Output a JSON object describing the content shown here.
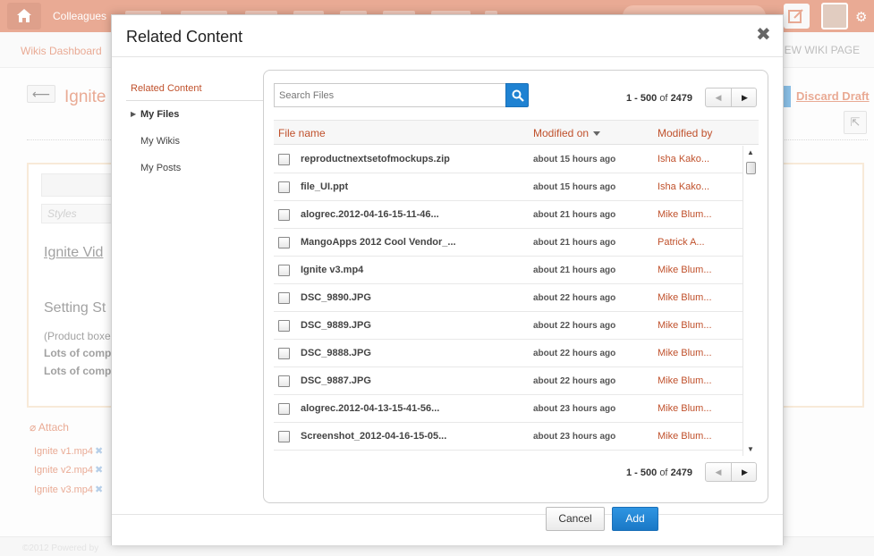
{
  "background": {
    "nav_colleagues": "Colleagues",
    "breadcrumb": "Wikis Dashboard",
    "new_wiki_page": "NEW WIKI PAGE",
    "back_arrow": "⟵",
    "page_title": "Ignite",
    "discard_draft": "Discard Draft",
    "styles_placeholder": "Styles",
    "editor_lines": [
      "Ignite Vid",
      "Setting St",
      "(Product boxe",
      "Lots of comp",
      "Lots of comp"
    ],
    "attach_label": "Attach",
    "attachments": [
      "Ignite v1.mp4",
      "Ignite v2.mp4",
      "Ignite v3.mp4"
    ],
    "remove_glyph": "✖",
    "footer_text": "©2012 Powered by"
  },
  "modal": {
    "title": "Related Content",
    "close_glyph": "✖",
    "nav": {
      "heading": "Related Content",
      "items": [
        {
          "label": "My Files",
          "active": true
        },
        {
          "label": "My Wikis",
          "active": false
        },
        {
          "label": "My Posts",
          "active": false
        }
      ]
    },
    "search": {
      "placeholder": "Search Files"
    },
    "pager": {
      "range": "1 - 500",
      "of": "of",
      "total": "2479"
    },
    "columns": {
      "name": "File name",
      "modified_on": "Modified on",
      "modified_by": "Modified by"
    },
    "files": [
      {
        "name": "reproductnextsetofmockups.zip",
        "modified_on": "about 15 hours ago",
        "modified_by": "Isha Kako..."
      },
      {
        "name": "file_UI.ppt",
        "modified_on": "about 15 hours ago",
        "modified_by": "Isha Kako..."
      },
      {
        "name": "alogrec.2012-04-16-15-11-46...",
        "modified_on": "about 21 hours ago",
        "modified_by": "Mike Blum..."
      },
      {
        "name": "MangoApps 2012 Cool Vendor_...",
        "modified_on": "about 21 hours ago",
        "modified_by": "Patrick A..."
      },
      {
        "name": "Ignite v3.mp4",
        "modified_on": "about 21 hours ago",
        "modified_by": "Mike Blum..."
      },
      {
        "name": "DSC_9890.JPG",
        "modified_on": "about 22 hours ago",
        "modified_by": "Mike Blum..."
      },
      {
        "name": "DSC_9889.JPG",
        "modified_on": "about 22 hours ago",
        "modified_by": "Mike Blum..."
      },
      {
        "name": "DSC_9888.JPG",
        "modified_on": "about 22 hours ago",
        "modified_by": "Mike Blum..."
      },
      {
        "name": "DSC_9887.JPG",
        "modified_on": "about 22 hours ago",
        "modified_by": "Mike Blum..."
      },
      {
        "name": "alogrec.2012-04-13-15-41-56...",
        "modified_on": "about 23 hours ago",
        "modified_by": "Mike Blum..."
      },
      {
        "name": "Screenshot_2012-04-16-15-05...",
        "modified_on": "about 23 hours ago",
        "modified_by": "Mike Blum..."
      }
    ],
    "buttons": {
      "cancel": "Cancel",
      "add": "Add"
    }
  },
  "colors": {
    "accent": "#d8643c",
    "link": "#c0512c",
    "primary_button": "#1f82d2"
  },
  "icons": [
    "home-icon",
    "search-icon",
    "gear-icon",
    "compose-icon",
    "close-icon",
    "sort-desc-icon",
    "chevron-right-icon",
    "paperclip-icon"
  ]
}
